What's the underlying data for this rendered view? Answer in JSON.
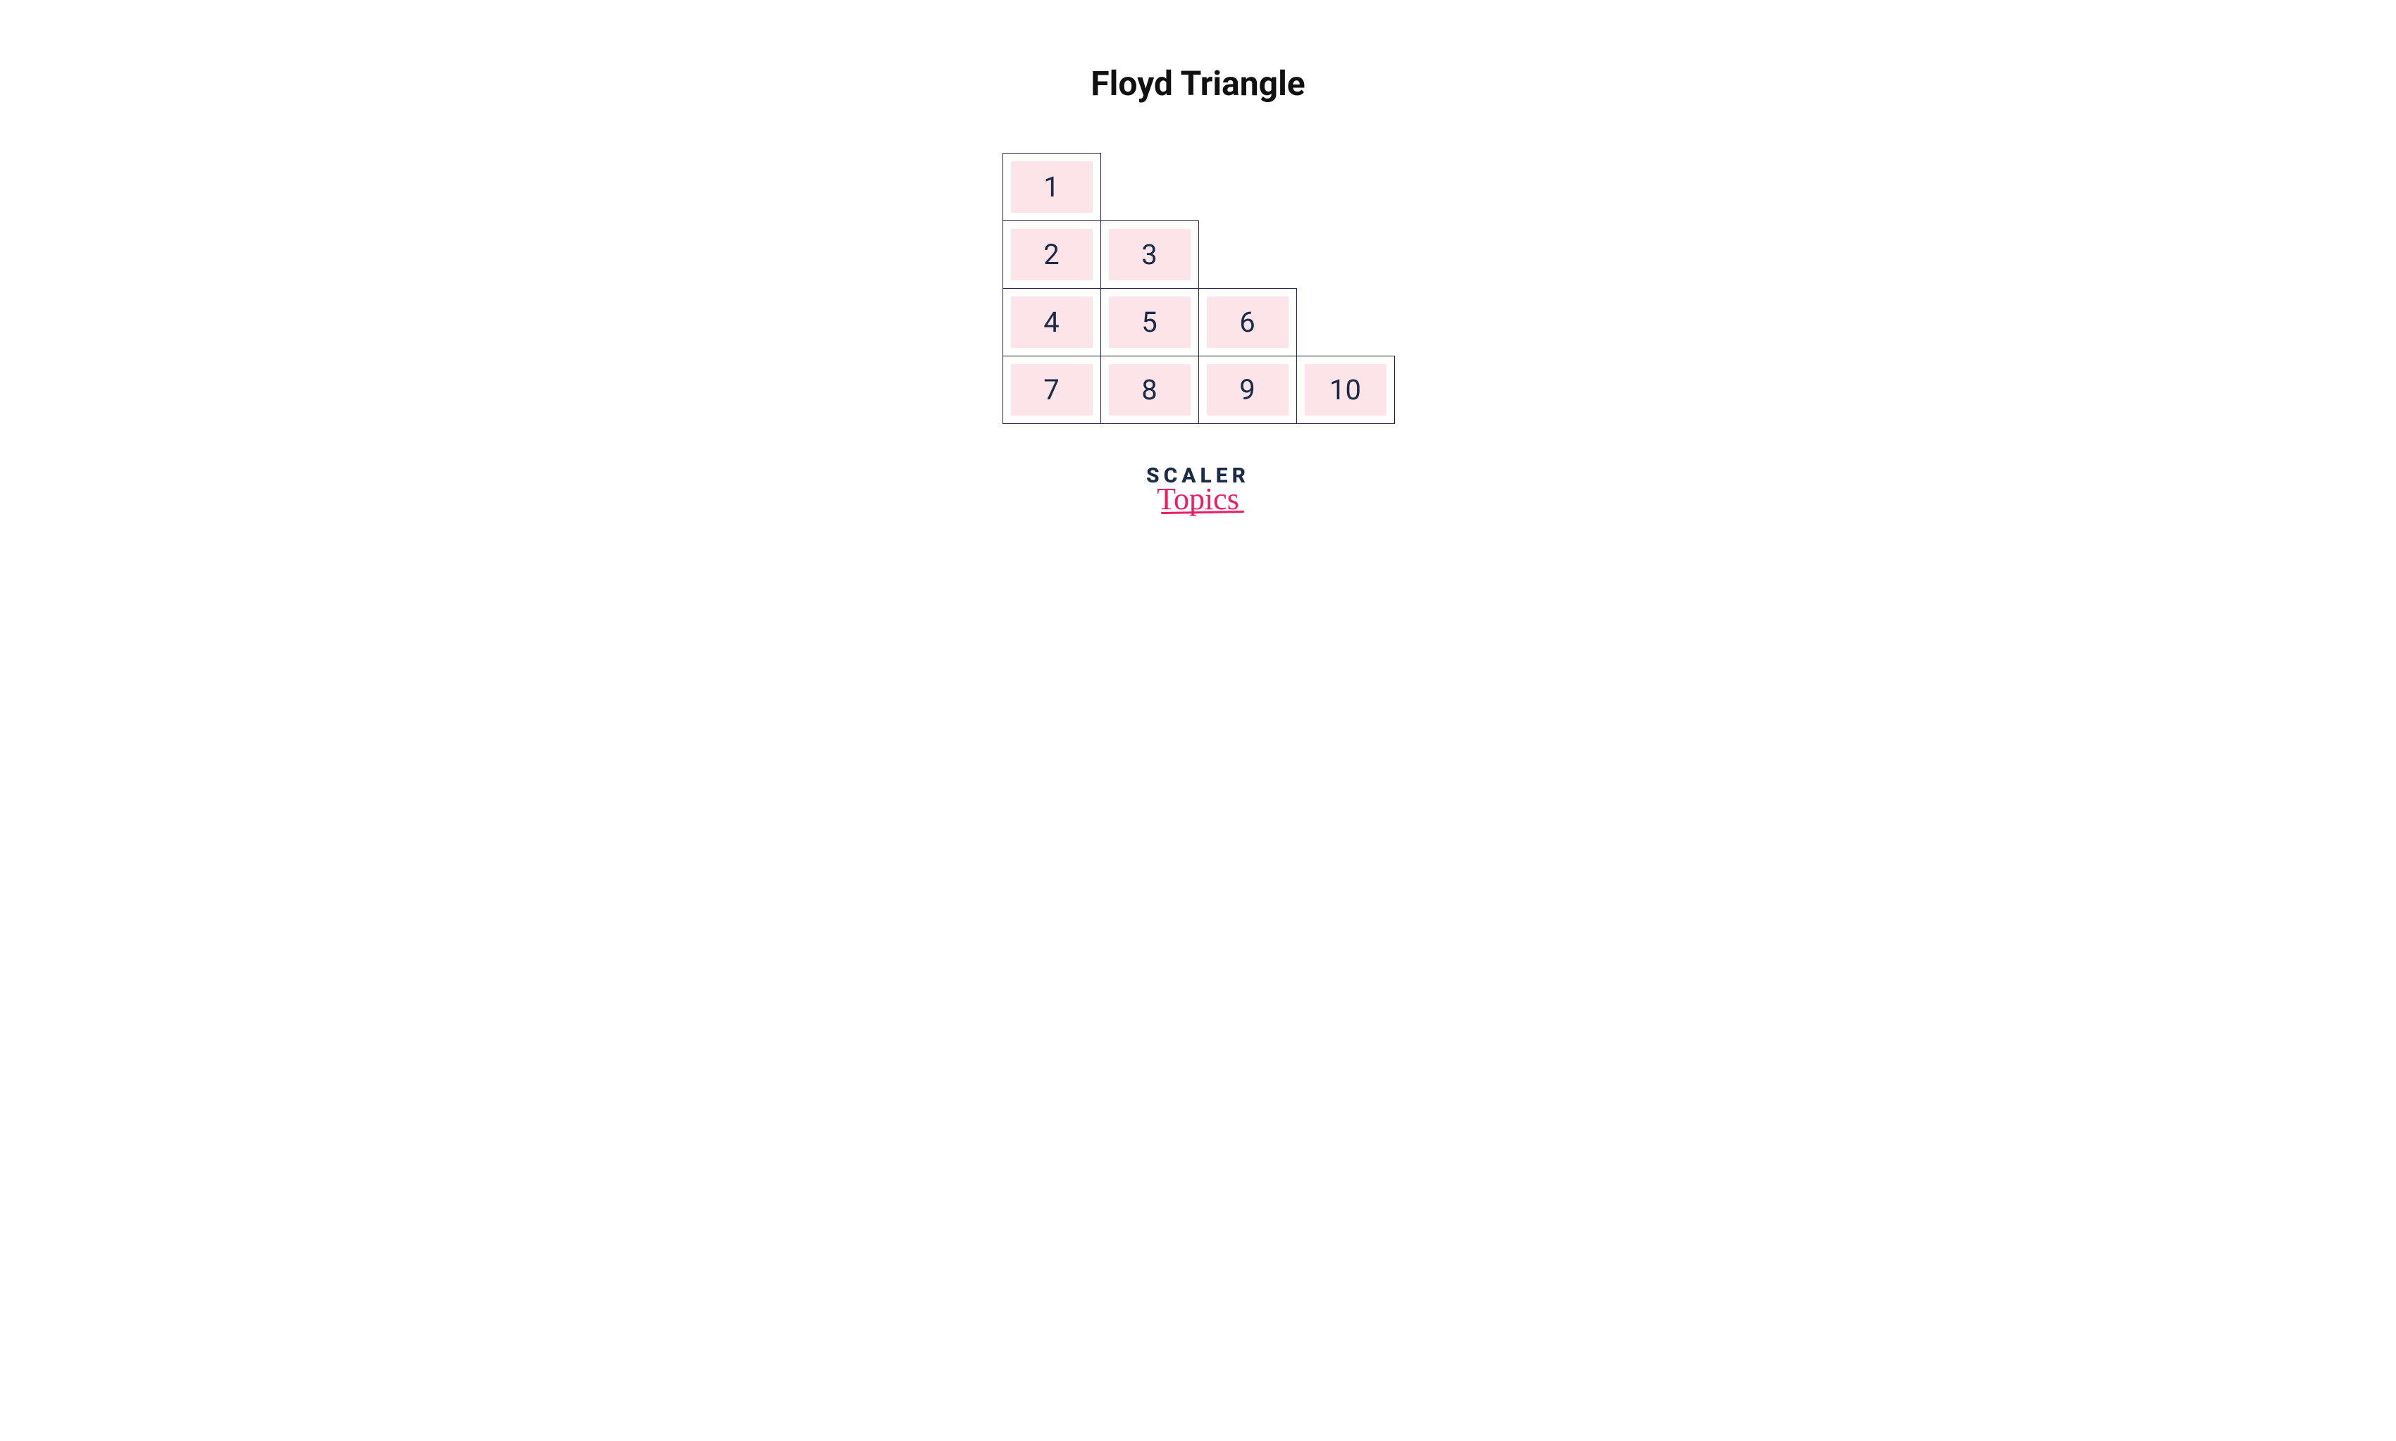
{
  "title": "Floyd Triangle",
  "triangle": {
    "rows": [
      [
        "1"
      ],
      [
        "2",
        "3"
      ],
      [
        "4",
        "5",
        "6"
      ],
      [
        "7",
        "8",
        "9",
        "10"
      ]
    ]
  },
  "logo": {
    "main": "SCALER",
    "sub": "Topics"
  },
  "colors": {
    "cell_border": "#1b2a46",
    "cell_fill": "#fce4e8",
    "text": "#1b2a46",
    "accent": "#e91e63"
  }
}
